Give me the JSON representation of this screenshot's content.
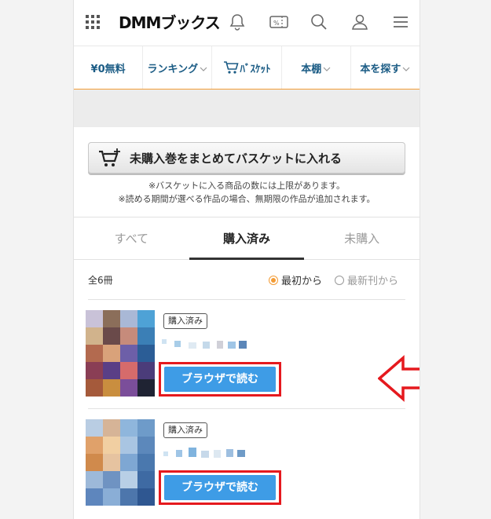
{
  "header": {
    "logo": "DMMブックス",
    "icons": [
      "grid-menu-icon",
      "bell-icon",
      "coupon-icon",
      "search-icon",
      "user-icon",
      "hamburger-icon"
    ]
  },
  "nav": {
    "items": [
      {
        "label": "¥0無料",
        "chevron": false
      },
      {
        "label": "ランキング",
        "chevron": true
      },
      {
        "label": "ﾊﾞｽｹｯﾄ",
        "chevron": false
      },
      {
        "label": "本棚",
        "chevron": true
      },
      {
        "label": "本を探す",
        "chevron": true
      }
    ]
  },
  "bulk_button": {
    "label": "未購入巻をまとめてバスケットに入れる"
  },
  "notes": [
    "※バスケットに入る商品の数には上限があります。",
    "※読める期間が選べる作品の場合、無期限の作品が追加されます。"
  ],
  "tabs": [
    {
      "label": "すべて",
      "active": false
    },
    {
      "label": "購入済み",
      "active": true
    },
    {
      "label": "未購入",
      "active": false
    }
  ],
  "list": {
    "count": "全6冊",
    "sort_options": [
      {
        "label": "最初から",
        "selected": true
      },
      {
        "label": "最新刊から",
        "selected": false
      }
    ]
  },
  "books": [
    {
      "badge": "購入済み",
      "button": "ブラウザで読む"
    },
    {
      "badge": "購入済み",
      "button": "ブラウザで読む"
    }
  ],
  "colors": {
    "accent": "#f39c36",
    "nav_text": "#1b5c85",
    "read_button": "#3e9ce6",
    "highlight": "#e5191e"
  }
}
